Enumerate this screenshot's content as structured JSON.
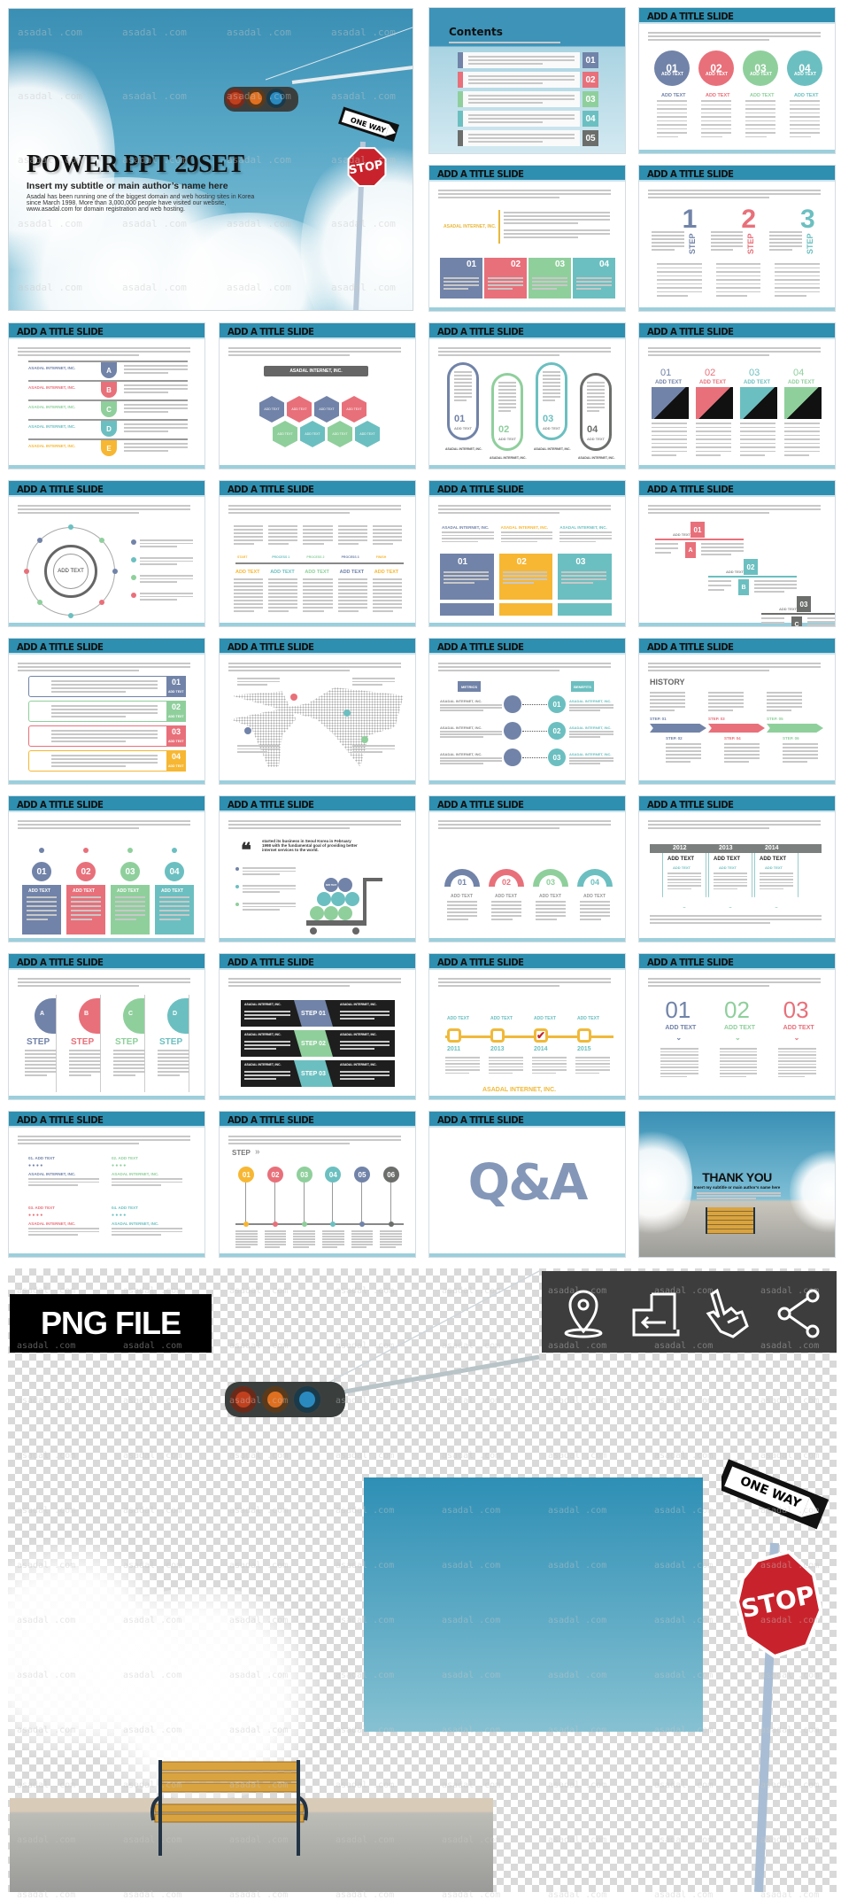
{
  "watermark": "asadal .com",
  "palette": {
    "blue": "#7183a8",
    "red": "#e8707a",
    "green": "#8fcf9c",
    "teal": "#6cbfc0",
    "yellow": "#f7b733",
    "gray": "#6b6e6b",
    "title_bar": "#2e8fb0"
  },
  "hero": {
    "title": "POWER PPT 29SET",
    "subtitle": "Insert my subtitle or main author’s name here",
    "body_lines": [
      "Asadal has been running one of the biggest domain and web hosting sites in Korea",
      "since March 1998. More than 3,000,000 people have visited our website,",
      "www.asadal.com for domain registration and web hosting."
    ],
    "sign_one_way": "ONE WAY",
    "sign_stop": "STOP"
  },
  "slides": [
    {
      "type": "contents",
      "title": "Contents",
      "items": [
        {
          "num": "01",
          "color": "blue"
        },
        {
          "num": "02",
          "color": "red"
        },
        {
          "num": "03",
          "color": "green"
        },
        {
          "num": "04",
          "color": "teal"
        },
        {
          "num": "05",
          "color": "gray"
        }
      ]
    },
    {
      "type": "circles",
      "title": "ADD A TITLE SLIDE",
      "items": [
        {
          "num": "01",
          "sub": "ADD TEXT",
          "label": "ADD TEXT",
          "color": "blue"
        },
        {
          "num": "02",
          "sub": "ADD TEXT",
          "label": "ADD TEXT",
          "color": "red"
        },
        {
          "num": "03",
          "sub": "ADD TEXT",
          "label": "ADD TEXT",
          "color": "green"
        },
        {
          "num": "04",
          "sub": "ADD TEXT",
          "label": "ADD TEXT",
          "color": "teal"
        }
      ]
    },
    {
      "type": "boxes",
      "title": "ADD A TITLE SLIDE",
      "side_label": "ASADAL INTERNET, INC.",
      "items": [
        {
          "num": "01",
          "color": "blue"
        },
        {
          "num": "02",
          "color": "red"
        },
        {
          "num": "03",
          "color": "green"
        },
        {
          "num": "04",
          "color": "teal"
        }
      ]
    },
    {
      "type": "bignum",
      "title": "ADD A TITLE SLIDE",
      "items": [
        {
          "num": "1",
          "sub": "STEP",
          "color": "blue"
        },
        {
          "num": "2",
          "sub": "STEP",
          "color": "red"
        },
        {
          "num": "3",
          "sub": "STEP",
          "color": "teal"
        }
      ]
    },
    {
      "type": "rows",
      "title": "ADD A TITLE SLIDE",
      "items": [
        {
          "num": "A",
          "label": "ASADAL INTERNET, INC.",
          "color": "blue"
        },
        {
          "num": "B",
          "label": "ASADAL INTERNET, INC.",
          "color": "red"
        },
        {
          "num": "C",
          "label": "ASADAL INTERNET, INC.",
          "color": "green"
        },
        {
          "num": "D",
          "label": "ASADAL INTERNET, INC.",
          "color": "teal"
        },
        {
          "num": "E",
          "label": "ASADAL INTERNET, INC.",
          "color": "yellow"
        }
      ]
    },
    {
      "type": "hex",
      "title": "ADD A TITLE SLIDE",
      "header": "ASADAL INTERNET, INC.",
      "items": [
        {
          "num": "ADD TEXT",
          "color": "blue"
        },
        {
          "num": "ADD TEXT",
          "color": "red"
        },
        {
          "num": "ADD TEXT",
          "color": "blue"
        },
        {
          "num": "ADD TEXT",
          "color": "red"
        },
        {
          "num": "ADD TEXT",
          "color": "green"
        },
        {
          "num": "ADD TEXT",
          "color": "teal"
        },
        {
          "num": "ADD TEXT",
          "color": "green"
        },
        {
          "num": "ADD TEXT",
          "color": "teal"
        }
      ]
    },
    {
      "type": "capsules",
      "title": "ADD A TITLE SLIDE",
      "items": [
        {
          "num": "01",
          "sub": "ADD TEXT",
          "label": "ASADAL INTERNET, INC.",
          "color": "blue"
        },
        {
          "num": "02",
          "sub": "ADD TEXT",
          "label": "ASADAL INTERNET, INC.",
          "color": "green"
        },
        {
          "num": "03",
          "sub": "ADD TEXT",
          "label": "ASADAL INTERNET, INC.",
          "color": "teal"
        },
        {
          "num": "04",
          "sub": "ADD TEXT",
          "label": "ASADAL INTERNET, INC.",
          "color": "gray"
        }
      ]
    },
    {
      "type": "squares",
      "title": "ADD A TITLE SLIDE",
      "items": [
        {
          "num": "01",
          "sub": "ADD TEXT",
          "color": "blue"
        },
        {
          "num": "02",
          "sub": "ADD TEXT",
          "color": "red"
        },
        {
          "num": "03",
          "sub": "ADD TEXT",
          "color": "teal"
        },
        {
          "num": "04",
          "sub": "ADD TEXT",
          "color": "green"
        }
      ]
    },
    {
      "type": "ring",
      "title": "ADD A TITLE SLIDE",
      "center": "ADD TEXT",
      "items": [
        {
          "color": "blue"
        },
        {
          "color": "teal"
        },
        {
          "color": "green"
        },
        {
          "color": "red"
        }
      ]
    },
    {
      "type": "timeline",
      "title": "ADD A TITLE SLIDE",
      "items": [
        {
          "label": "START",
          "sub": "ADD TEXT",
          "color": "yellow"
        },
        {
          "label": "PROCESS 1",
          "sub": "ADD TEXT",
          "color": "teal"
        },
        {
          "label": "PROCESS 2",
          "sub": "ADD TEXT",
          "color": "green"
        },
        {
          "label": "PROCESS 3",
          "sub": "ADD TEXT",
          "color": "blue"
        },
        {
          "label": "FINISH",
          "sub": "ADD TEXT",
          "color": "yellow"
        }
      ]
    },
    {
      "type": "boxes3",
      "title": "ADD A TITLE SLIDE",
      "items": [
        {
          "num": "01",
          "label": "ASADAL INTERNET, INC.",
          "color": "blue"
        },
        {
          "num": "02",
          "label": "ASADAL INTERNET, INC.",
          "color": "yellow"
        },
        {
          "num": "03",
          "label": "ASADAL INTERNET, INC.",
          "color": "teal"
        }
      ]
    },
    {
      "type": "stairs",
      "title": "ADD A TITLE SLIDE",
      "items": [
        {
          "num": "01",
          "letter": "A",
          "sub": "ADD TEXT",
          "color": "red"
        },
        {
          "num": "02",
          "letter": "B",
          "sub": "ADD TEXT",
          "color": "teal"
        },
        {
          "num": "03",
          "letter": "C",
          "sub": "ADD TEXT",
          "color": "gray"
        }
      ]
    },
    {
      "type": "cards",
      "title": "ADD A TITLE SLIDE",
      "items": [
        {
          "num": "01",
          "sub": "ADD TEXT",
          "color": "blue"
        },
        {
          "num": "02",
          "sub": "ADD TEXT",
          "color": "green"
        },
        {
          "num": "03",
          "sub": "ADD TEXT",
          "color": "red"
        },
        {
          "num": "04",
          "sub": "ADD TEXT",
          "color": "yellow"
        }
      ]
    },
    {
      "type": "map",
      "title": "ADD A TITLE SLIDE",
      "items": [
        {
          "color": "red"
        },
        {
          "color": "teal"
        },
        {
          "color": "blue"
        },
        {
          "color": "green"
        }
      ]
    },
    {
      "type": "metrics",
      "title": "ADD A TITLE SLIDE",
      "left_tag": "METRICS",
      "right_tag": "BENEFITS",
      "items": [
        {
          "num": "01",
          "label": "ASADAL INTERNET, INC."
        },
        {
          "num": "02",
          "label": "ASADAL INTERNET, INC."
        },
        {
          "num": "03",
          "label": "ASADAL INTERNET, INC."
        }
      ]
    },
    {
      "type": "history",
      "title": "ADD A TITLE SLIDE",
      "heading": "HISTORY",
      "items": [
        {
          "label": "STEP. 01",
          "color": "blue"
        },
        {
          "label": "STEP. 02",
          "color": "blue"
        },
        {
          "label": "STEP. 03",
          "color": "red"
        },
        {
          "label": "STEP. 04",
          "color": "red"
        },
        {
          "label": "STEP. 05",
          "color": "green"
        },
        {
          "label": "STEP. 06",
          "color": "green"
        }
      ]
    },
    {
      "type": "circles",
      "variant": "cards",
      "title": "ADD A TITLE SLIDE",
      "items": [
        {
          "num": "01",
          "label": "ADD TEXT",
          "color": "blue"
        },
        {
          "num": "02",
          "label": "ADD TEXT",
          "color": "red"
        },
        {
          "num": "03",
          "label": "ADD TEXT",
          "color": "green"
        },
        {
          "num": "04",
          "label": "ADD TEXT",
          "color": "teal"
        }
      ]
    },
    {
      "type": "cart",
      "title": "ADD A TITLE SLIDE",
      "quote": "started its business in Seoul Korea in February 1998 with the fundamental goal of providing better internet services to the world.",
      "ball": "ADD TEXT",
      "items": [
        {
          "color": "blue"
        },
        {
          "color": "teal"
        },
        {
          "color": "green"
        }
      ]
    },
    {
      "type": "circles",
      "variant": "arcs",
      "title": "ADD A TITLE SLIDE",
      "items": [
        {
          "num": "01",
          "label": "ADD TEXT",
          "color": "blue"
        },
        {
          "num": "02",
          "label": "ADD TEXT",
          "color": "red"
        },
        {
          "num": "03",
          "label": "ADD TEXT",
          "color": "green"
        },
        {
          "num": "04",
          "label": "ADD TEXT",
          "color": "teal"
        }
      ]
    },
    {
      "type": "years",
      "title": "ADD A TITLE SLIDE",
      "items": [
        {
          "num": "2012",
          "label": "ADD TEXT",
          "sub": "ADD TEXT"
        },
        {
          "num": "2013",
          "label": "ADD TEXT",
          "sub": "ADD TEXT"
        },
        {
          "num": "2014",
          "label": "ADD TEXT",
          "sub": "ADD TEXT"
        }
      ]
    },
    {
      "type": "bignum",
      "variant": "half",
      "title": "ADD A TITLE SLIDE",
      "items": [
        {
          "num": "A",
          "sub": "STEP",
          "color": "blue"
        },
        {
          "num": "B",
          "sub": "STEP",
          "color": "red"
        },
        {
          "num": "C",
          "sub": "STEP",
          "color": "green"
        },
        {
          "num": "D",
          "sub": "STEP",
          "color": "teal"
        }
      ]
    },
    {
      "type": "stepbars",
      "title": "ADD A TITLE SLIDE",
      "items": [
        {
          "num": "STEP 01",
          "label": "ASADAL INTERNET, INC.",
          "color": "blue"
        },
        {
          "num": "STEP 02",
          "label": "ASADAL INTERNET, INC.",
          "color": "green"
        },
        {
          "num": "STEP 03",
          "label": "ASADAL INTERNET, INC.",
          "color": "teal"
        }
      ]
    },
    {
      "type": "timeline",
      "variant": "years",
      "title": "ADD A TITLE SLIDE",
      "footer": "ASADAL INTERNET, INC.",
      "items": [
        {
          "label": "ADD TEXT",
          "sub": "2011",
          "color": "yellow"
        },
        {
          "label": "ADD TEXT",
          "sub": "2013",
          "color": "yellow"
        },
        {
          "label": "ADD TEXT",
          "sub": "2014",
          "color": "yellow",
          "checked": true
        },
        {
          "label": "ADD TEXT",
          "sub": "2015",
          "color": "yellow"
        }
      ]
    },
    {
      "type": "bignum",
      "variant": "outline",
      "title": "ADD A TITLE SLIDE",
      "items": [
        {
          "num": "01",
          "sub": "ADD TEXT",
          "color": "blue"
        },
        {
          "num": "02",
          "sub": "ADD TEXT",
          "color": "green"
        },
        {
          "num": "03",
          "sub": "ADD TEXT",
          "color": "red"
        }
      ]
    },
    {
      "type": "twocol",
      "title": "ADD A TITLE SLIDE",
      "items": [
        {
          "num": "01. ADD TEXT",
          "label": "ASADAL INTERNET, INC.",
          "color": "blue"
        },
        {
          "num": "02. ADD TEXT",
          "label": "ASADAL INTERNET, INC.",
          "color": "green"
        },
        {
          "num": "03. ADD TEXT",
          "label": "ASADAL INTERNET, INC.",
          "color": "red"
        },
        {
          "num": "04. ADD TEXT",
          "label": "ASADAL INTERNET, INC.",
          "color": "teal"
        }
      ]
    },
    {
      "type": "timeline",
      "variant": "dots",
      "title": "ADD A TITLE SLIDE",
      "heading": "STEP",
      "items": [
        {
          "label": "01",
          "color": "yellow"
        },
        {
          "label": "02",
          "color": "red"
        },
        {
          "label": "03",
          "color": "green"
        },
        {
          "label": "04",
          "color": "teal"
        },
        {
          "label": "05",
          "color": "blue"
        },
        {
          "label": "06",
          "color": "gray"
        }
      ]
    },
    {
      "type": "qa",
      "title": "ADD A TITLE SLIDE",
      "text": "Q&A"
    },
    {
      "type": "thanks",
      "title": "THANK YOU",
      "subtitle": "Insert my subtitle or main author’s name here"
    }
  ],
  "png_section": {
    "label": "PNG FILE",
    "icons": [
      "map-pin-icon",
      "door-exit-icon",
      "hand-pointer-icon",
      "share-icon"
    ],
    "sign_one_way": "ONE WAY",
    "sign_stop": "STOP"
  }
}
